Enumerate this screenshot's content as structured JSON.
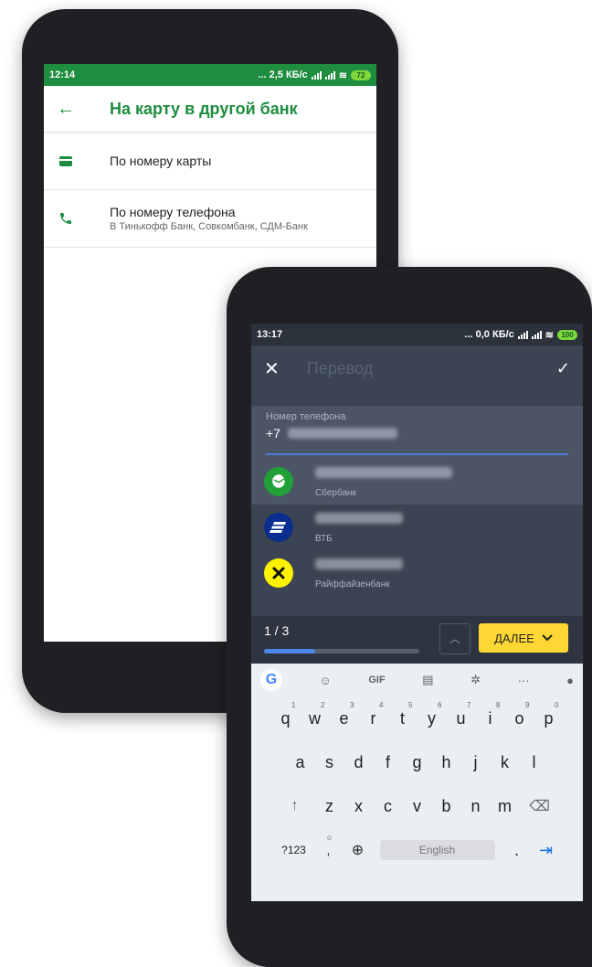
{
  "back_phone": {
    "status": {
      "time": "12:14",
      "speed": "... 2,5 КБ/с",
      "battery": "72"
    },
    "appbar": {
      "title": "На карту в другой банк"
    },
    "options": [
      {
        "label": "По номеру карты",
        "sub": ""
      },
      {
        "label": "По номеру телефона",
        "sub": "В Тинькофф Банк, Совкомбанк, СДМ-Банк"
      }
    ]
  },
  "front_phone": {
    "status": {
      "time": "13:17",
      "speed": "... 0,0 КБ/с",
      "battery": "100"
    },
    "toolbar": {
      "title": "Перевод"
    },
    "phone_field": {
      "label": "Номер телефона",
      "prefix": "+7"
    },
    "suggestions": [
      {
        "bank": "Сбербанк"
      },
      {
        "bank": "ВТБ"
      },
      {
        "bank": "Райффайзенбанк"
      }
    ],
    "nav": {
      "counter": "1 / 3",
      "next_label": "ДАЛЕЕ",
      "progress": 0.33
    },
    "keyboard": {
      "gif": "GIF",
      "row1": [
        {
          "k": "q",
          "s": "1"
        },
        {
          "k": "w",
          "s": "2"
        },
        {
          "k": "e",
          "s": "3"
        },
        {
          "k": "r",
          "s": "4"
        },
        {
          "k": "t",
          "s": "5"
        },
        {
          "k": "y",
          "s": "6"
        },
        {
          "k": "u",
          "s": "7"
        },
        {
          "k": "i",
          "s": "8"
        },
        {
          "k": "o",
          "s": "9"
        },
        {
          "k": "p",
          "s": "0"
        }
      ],
      "row2": [
        "a",
        "s",
        "d",
        "f",
        "g",
        "h",
        "j",
        "k",
        "l"
      ],
      "row3": [
        "z",
        "x",
        "c",
        "v",
        "b",
        "n",
        "m"
      ],
      "symbols": "?123",
      "space": "English",
      "period": "."
    }
  },
  "colors": {
    "sber_green": "#1e8d3f",
    "accent_yellow": "#fdd835",
    "dark_bg": "#3b4452"
  }
}
